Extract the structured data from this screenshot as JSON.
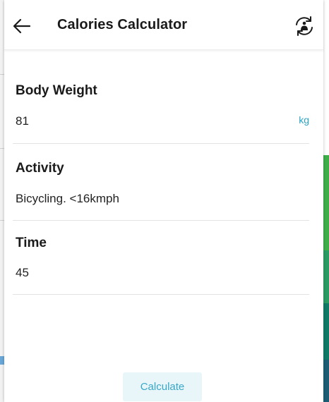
{
  "header": {
    "title": "Calories Calculator",
    "back_icon": "arrow-left-icon",
    "sync_icon": "refresh-icon"
  },
  "fields": {
    "body_weight": {
      "label": "Body Weight",
      "value": "81",
      "unit": "kg"
    },
    "activity": {
      "label": "Activity",
      "value": "Bicycling. <16kmph"
    },
    "time": {
      "label": "Time",
      "value": "45"
    }
  },
  "actions": {
    "calculate_label": "Calculate"
  },
  "colors": {
    "accent": "#29a3c4",
    "button_bg": "#e8f6fa",
    "text": "#1a1a1a",
    "divider": "#e3e3e3"
  }
}
